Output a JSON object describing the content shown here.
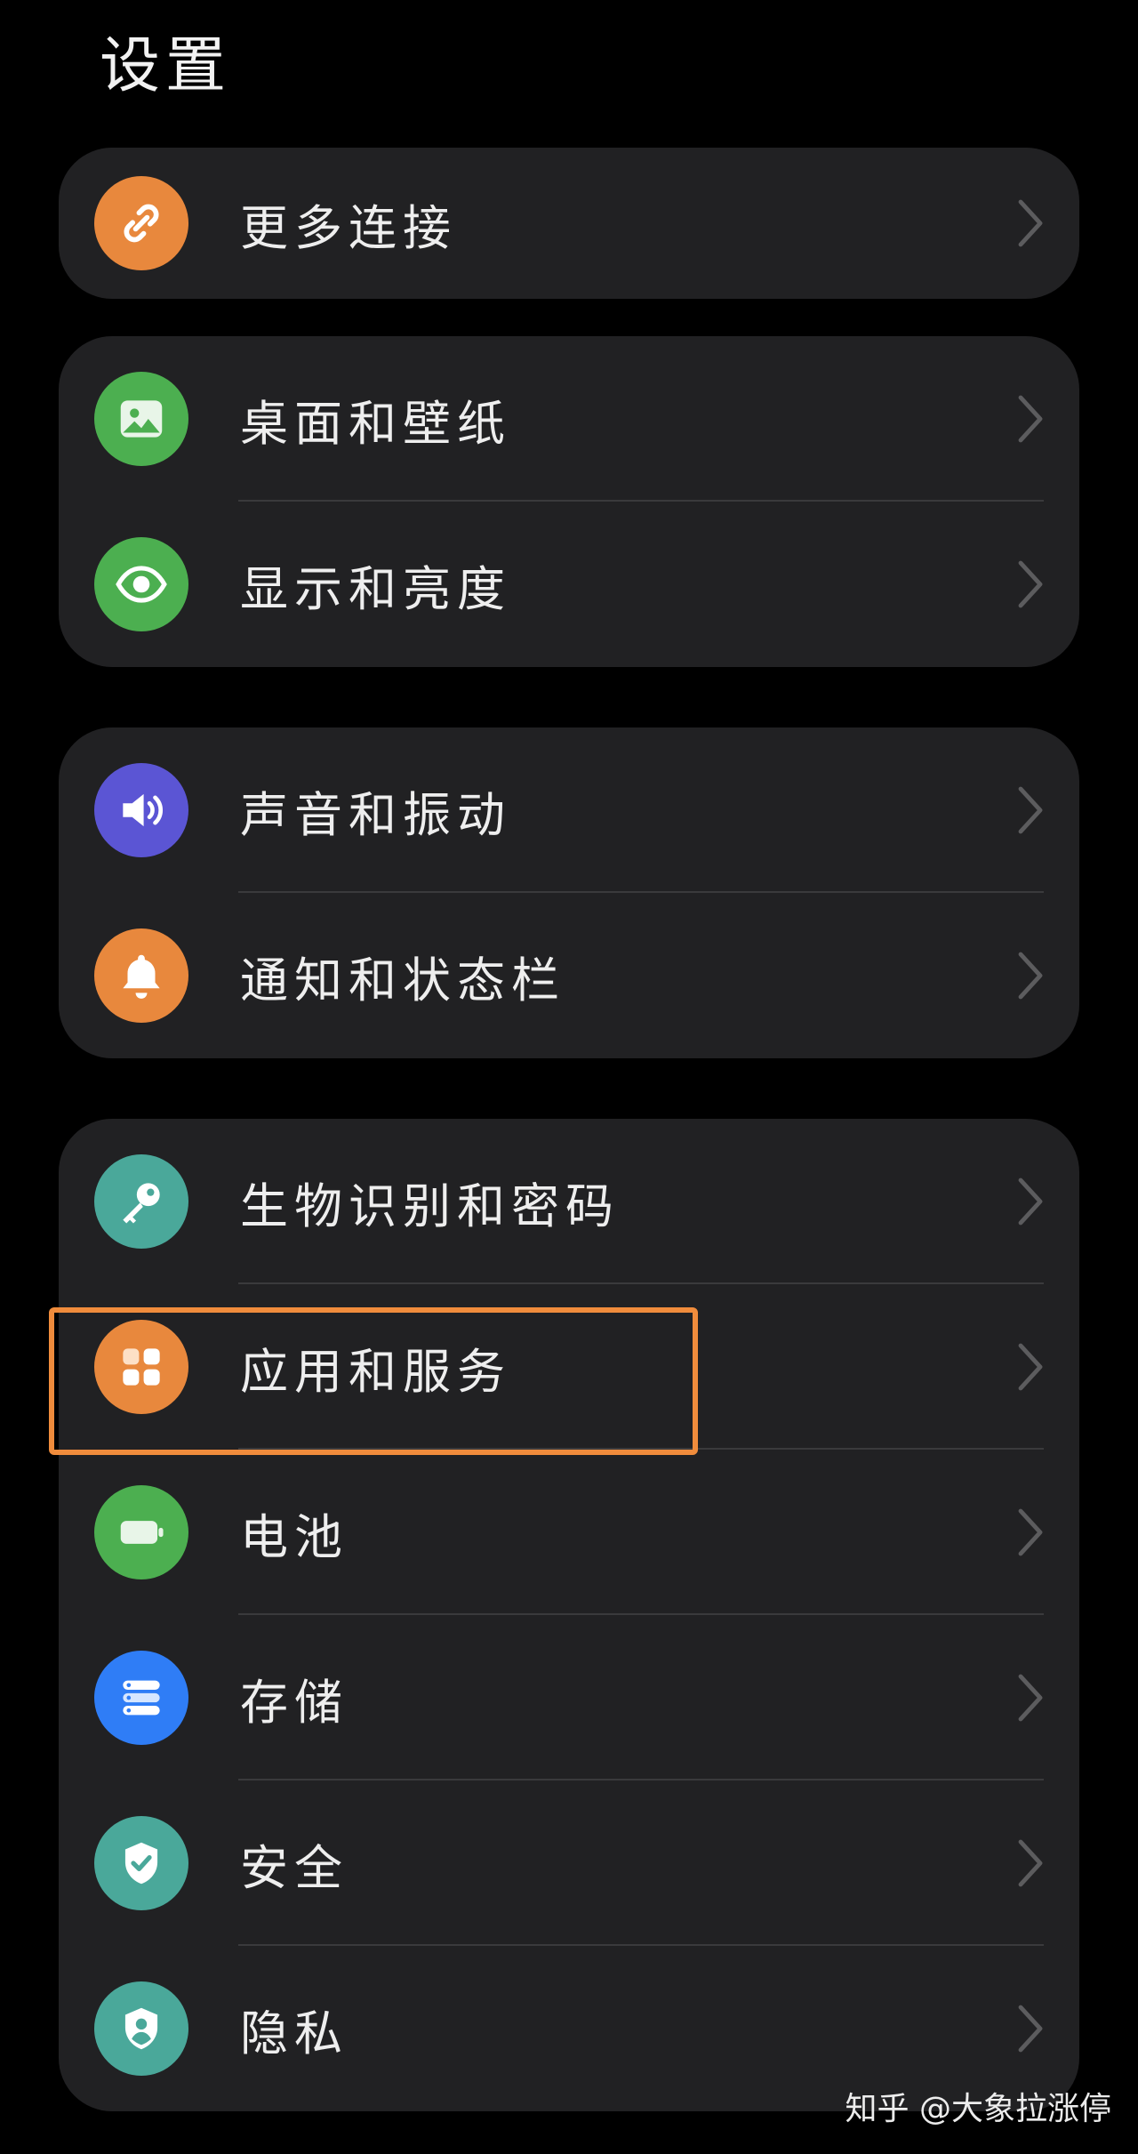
{
  "page": {
    "title": "设置"
  },
  "groups": [
    {
      "items": [
        {
          "label": "更多连接",
          "icon": "link-icon",
          "color": "#e8883d"
        }
      ]
    },
    {
      "items": [
        {
          "label": "桌面和壁纸",
          "icon": "wallpaper-icon",
          "color": "#4caf50"
        },
        {
          "label": "显示和亮度",
          "icon": "eye-icon",
          "color": "#4caf50"
        }
      ]
    },
    {
      "items": [
        {
          "label": "声音和振动",
          "icon": "speaker-icon",
          "color": "#5b55d4"
        },
        {
          "label": "通知和状态栏",
          "icon": "bell-icon",
          "color": "#e8883d"
        }
      ]
    },
    {
      "items": [
        {
          "label": "生物识别和密码",
          "icon": "key-icon",
          "color": "#4aa89a"
        },
        {
          "label": "应用和服务",
          "icon": "apps-grid-icon",
          "color": "#e8883d",
          "highlighted": true
        },
        {
          "label": "电池",
          "icon": "battery-icon",
          "color": "#4caf50"
        },
        {
          "label": "存储",
          "icon": "storage-icon",
          "color": "#2f7df6"
        },
        {
          "label": "安全",
          "icon": "shield-check-icon",
          "color": "#4aa89a"
        },
        {
          "label": "隐私",
          "icon": "privacy-shield-icon",
          "color": "#4aa89a"
        }
      ]
    }
  ],
  "highlight_color": "#f08c3c",
  "watermark": "知乎 @大象拉涨停"
}
